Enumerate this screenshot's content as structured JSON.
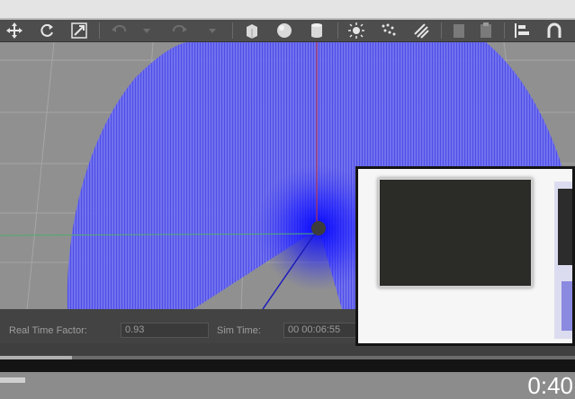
{
  "toolbar": {
    "icons": [
      "move-icon",
      "rotate-icon",
      "scale-icon",
      "undo-icon",
      "undo-dropdown-icon",
      "redo-icon",
      "redo-dropdown-icon",
      "box-icon",
      "sphere-icon",
      "cylinder-icon",
      "sun-light-icon",
      "point-light-icon",
      "spot-light-icon",
      "copy-icon",
      "paste-icon",
      "align-icon",
      "snap-icon"
    ]
  },
  "status": {
    "rtf_label": "Real Time Factor:",
    "rtf_value": "0.93",
    "sim_label": "Sim Time:",
    "sim_value": "00 00:06:55"
  },
  "player": {
    "time": "0:40"
  },
  "colors": {
    "laser": "#3a3aee",
    "grid_bg": "#909090",
    "axis_red": "#cc3333",
    "axis_green": "#33aa55"
  }
}
